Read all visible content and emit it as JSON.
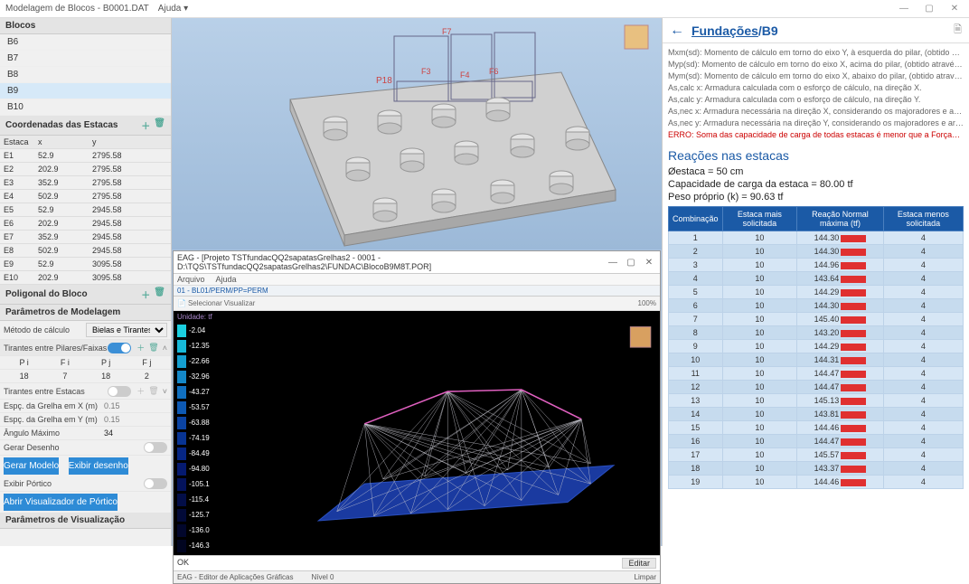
{
  "window": {
    "title": "Modelagem de Blocos - B0001.DAT",
    "help": "Ajuda ▾"
  },
  "left": {
    "blocos_title": "Blocos",
    "blocos": [
      "B6",
      "B7",
      "B8",
      "B9",
      "B10"
    ],
    "selected_bloco": 3,
    "coord_title": "Coordenadas das Estacas",
    "coord_headers": [
      "Estaca",
      "x",
      "y"
    ],
    "coords": [
      [
        "E1",
        "52.9",
        "2795.58"
      ],
      [
        "E2",
        "202.9",
        "2795.58"
      ],
      [
        "E3",
        "352.9",
        "2795.58"
      ],
      [
        "E4",
        "502.9",
        "2795.58"
      ],
      [
        "E5",
        "52.9",
        "2945.58"
      ],
      [
        "E6",
        "202.9",
        "2945.58"
      ],
      [
        "E7",
        "352.9",
        "2945.58"
      ],
      [
        "E8",
        "502.9",
        "2945.58"
      ],
      [
        "E9",
        "52.9",
        "3095.58"
      ],
      [
        "E10",
        "202.9",
        "3095.58"
      ]
    ],
    "poligonal_title": "Poligonal do Bloco",
    "params_title": "Parâmetros de Modelagem",
    "metodo_label": "Método de cálculo",
    "metodo_value": "Bielas e Tirantes",
    "tirantes_pf_title": "Tirantes entre Pilares/Faixas",
    "pf_headers": [
      "P i",
      "F i",
      "P j",
      "F j"
    ],
    "pf_row": [
      "18",
      "7",
      "18",
      "2"
    ],
    "tirantes_estacas": "Tirantes entre Estacas",
    "espc_x": "Espç. da Grelha em X (m)",
    "espc_x_v": "0.15",
    "espc_y": "Espç. da Grelha em Y (m)",
    "espc_y_v": "0.15",
    "ang_max": "Ângulo Máximo",
    "ang_max_v": "34",
    "gerar_desenho": "Gerar Desenho",
    "btn_gerar": "Gerar Modelo",
    "btn_exibir": "Exibir desenho",
    "exibir_portico": "Exibir Pórtico",
    "btn_visualizador": "Abrir Visualizador de Pórtico",
    "params_vis": "Parâmetros de Visualização"
  },
  "center": {
    "menu": "Ajuda ▾",
    "labels3d": {
      "p18": "P18",
      "f7": "F7",
      "f3": "F3",
      "f6": "F6",
      "f4": "F4"
    },
    "eag_title": "EAG - [Projeto TSTfundacQQ2sapatasGrelhas2 - 0001 - D:\\TQS\\TSTfundacQQ2sapatasGrelhas2\\FUNDAC\\BlocoB9M8T.POR]",
    "eag_menu": [
      "Arquivo",
      "Ajuda"
    ],
    "eag_tab": "01 - BL01/PERM/PP=PERM",
    "eag_modes": [
      "Selecionar",
      "Visualizar"
    ],
    "eag_zoom": "100%",
    "scale_unit": "Unidade: tf",
    "scale": [
      {
        "c": "#1bd0e0",
        "v": "-2.04"
      },
      {
        "c": "#17b9d8",
        "v": "-12.35"
      },
      {
        "c": "#149fd0",
        "v": "-22.66"
      },
      {
        "c": "#1488c8",
        "v": "-32.96"
      },
      {
        "c": "#1070c0",
        "v": "-43.27"
      },
      {
        "c": "#0d59b4",
        "v": "-53.57"
      },
      {
        "c": "#0b44a4",
        "v": "-63.88"
      },
      {
        "c": "#083494",
        "v": "-74.19"
      },
      {
        "c": "#062684",
        "v": "-84.49"
      },
      {
        "c": "#051a70",
        "v": "-94.80"
      },
      {
        "c": "#04135c",
        "v": "-105.1"
      },
      {
        "c": "#030e48",
        "v": "-115.4"
      },
      {
        "c": "#020a38",
        "v": "-125.7"
      },
      {
        "c": "#02072c",
        "v": "-136.0"
      },
      {
        "c": "#010520",
        "v": "-146.3"
      }
    ],
    "ok": "OK",
    "editar": "Editar",
    "footer": "EAG - Editor de Aplicações Gráficas",
    "nivel": "Nível 0",
    "limpar": "Limpar"
  },
  "right": {
    "breadcrumb_root": "Fundações",
    "breadcrumb_sep": " / ",
    "breadcrumb_leaf": "B9",
    "desc": [
      "Mxm(sd): Momento de cálculo em torno do eixo Y, à esquerda do pilar, (obtido através da…",
      "Myp(sd): Momento de cálculo em torno do eixo X, acima do pilar, (obtido através da Σ(Ca…",
      "Mym(sd): Momento de cálculo em torno do eixo X, abaixo do pilar, (obtido através da Σ(C…",
      "As,calc x: Armadura calculada com o esforço de cálculo, na direção X.",
      "As,calc y: Armadura calculada com o esforço de cálculo, na direção Y.",
      "As,nec x: Armadura necessária na direção X, considerando os majoradores e armadura m…",
      "As,nec y: Armadura necessária na direção Y, considerando os majoradores e armadura m…"
    ],
    "err": "ERRO: Soma das capacidade de carga de todas estacas é menor que a Força…",
    "section": "Reações nas estacas",
    "diam": "Øestaca = 50 cm",
    "cap": "Capacidade de carga da estaca = 80.00 tf",
    "peso": "Peso próprio (k) = 90.63 tf",
    "thead": [
      "Combinação",
      "Estaca mais solicitada",
      "Reação Normal máxima (tf)",
      "Estaca menos solicitada"
    ],
    "rows": [
      [
        "1",
        "10",
        "144.30",
        "4"
      ],
      [
        "2",
        "10",
        "144.30",
        "4"
      ],
      [
        "3",
        "10",
        "144.96",
        "4"
      ],
      [
        "4",
        "10",
        "143.64",
        "4"
      ],
      [
        "5",
        "10",
        "144.29",
        "4"
      ],
      [
        "6",
        "10",
        "144.30",
        "4"
      ],
      [
        "7",
        "10",
        "145.40",
        "4"
      ],
      [
        "8",
        "10",
        "143.20",
        "4"
      ],
      [
        "9",
        "10",
        "144.29",
        "4"
      ],
      [
        "10",
        "10",
        "144.31",
        "4"
      ],
      [
        "11",
        "10",
        "144.47",
        "4"
      ],
      [
        "12",
        "10",
        "144.47",
        "4"
      ],
      [
        "13",
        "10",
        "145.13",
        "4"
      ],
      [
        "14",
        "10",
        "143.81",
        "4"
      ],
      [
        "15",
        "10",
        "144.46",
        "4"
      ],
      [
        "16",
        "10",
        "144.47",
        "4"
      ],
      [
        "17",
        "10",
        "145.57",
        "4"
      ],
      [
        "18",
        "10",
        "143.37",
        "4"
      ],
      [
        "19",
        "10",
        "144.46",
        "4"
      ]
    ]
  }
}
